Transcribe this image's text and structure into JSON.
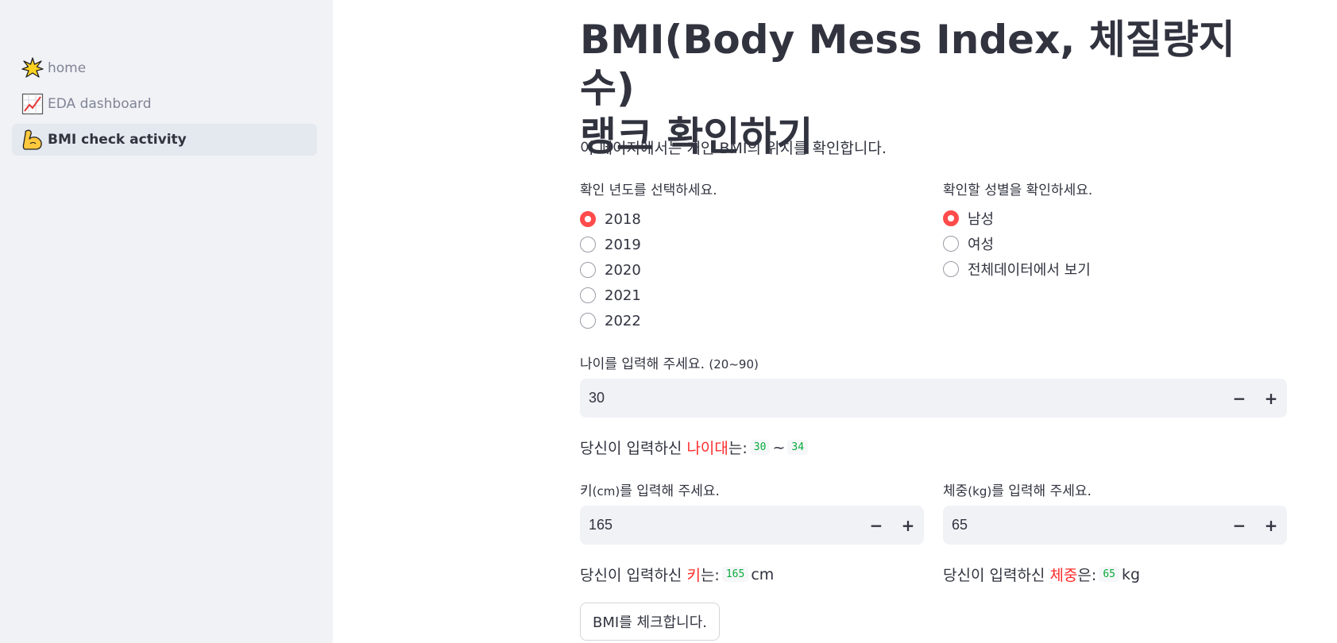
{
  "sidebar": {
    "items": [
      {
        "label": "home",
        "icon": "sparkle-icon"
      },
      {
        "label": "EDA dashboard",
        "icon": "chart-increasing-icon"
      },
      {
        "label": "BMI check activity",
        "icon": "flexed-biceps-icon",
        "active": true
      }
    ]
  },
  "main": {
    "title_line1": "BMI(Body Mess Index, 체질량지수)",
    "title_line2": "랭크 확인하기",
    "caption": "이 페이지에서는 개인 BMI의 위치를 확인합니다.",
    "year_label": "확인 년도를 선택하세요.",
    "years": [
      "2018",
      "2019",
      "2020",
      "2021",
      "2022"
    ],
    "selected_year": "2018",
    "gender_label": "확인할 성별을 확인하세요.",
    "genders": [
      "남성",
      "여성",
      "전체데이터에서 보기"
    ],
    "selected_gender": "남성",
    "age_label": "나이를 입력해 주세요.",
    "age_hint": "(20~90)",
    "age_value": "30",
    "age_out_prefix": "당신이 입력하신 ",
    "age_out_highlight": "나이대",
    "age_out_suffix": "는:",
    "age_range_from": "30",
    "age_range_sep": "~",
    "age_range_to": "34",
    "height_label_prefix": "키",
    "height_label_unit": "(cm)",
    "height_label_suffix": "를 입력해 주세요.",
    "height_value": "165",
    "weight_label_prefix": "체중",
    "weight_label_unit": "(kg)",
    "weight_label_suffix": "를 입력해 주세요.",
    "weight_value": "65",
    "height_out_prefix": "당신이 입력하신 ",
    "height_out_highlight": "키",
    "height_out_suffix": "는:",
    "height_out_value": "165",
    "height_out_unit": "cm",
    "weight_out_prefix": "당신이 입력하신 ",
    "weight_out_highlight": "체중",
    "weight_out_suffix": "은:",
    "weight_out_value": "65",
    "weight_out_unit": "kg",
    "minus": "−",
    "plus": "+",
    "check_button": "BMI를 체크합니다."
  },
  "colors": {
    "accent": "#ff4b4b",
    "highlight_text": "#ff2b2b",
    "code_text": "#09ab3b",
    "sidebar_bg": "#f0f2f6"
  }
}
